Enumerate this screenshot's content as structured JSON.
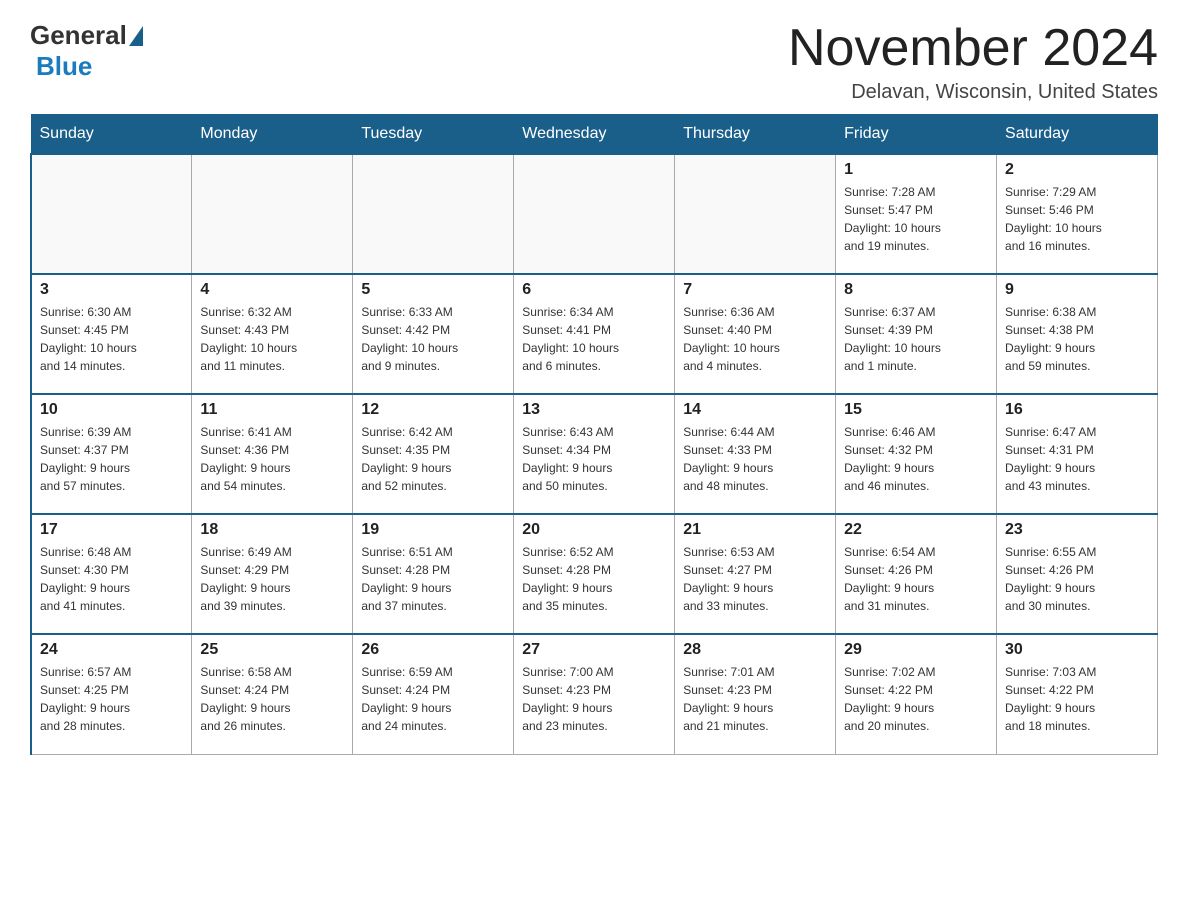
{
  "header": {
    "logo_general": "General",
    "logo_blue": "Blue",
    "title": "November 2024",
    "location": "Delavan, Wisconsin, United States"
  },
  "days_of_week": [
    "Sunday",
    "Monday",
    "Tuesday",
    "Wednesday",
    "Thursday",
    "Friday",
    "Saturday"
  ],
  "weeks": [
    {
      "days": [
        {
          "number": "",
          "info": ""
        },
        {
          "number": "",
          "info": ""
        },
        {
          "number": "",
          "info": ""
        },
        {
          "number": "",
          "info": ""
        },
        {
          "number": "",
          "info": ""
        },
        {
          "number": "1",
          "info": "Sunrise: 7:28 AM\nSunset: 5:47 PM\nDaylight: 10 hours\nand 19 minutes."
        },
        {
          "number": "2",
          "info": "Sunrise: 7:29 AM\nSunset: 5:46 PM\nDaylight: 10 hours\nand 16 minutes."
        }
      ]
    },
    {
      "days": [
        {
          "number": "3",
          "info": "Sunrise: 6:30 AM\nSunset: 4:45 PM\nDaylight: 10 hours\nand 14 minutes."
        },
        {
          "number": "4",
          "info": "Sunrise: 6:32 AM\nSunset: 4:43 PM\nDaylight: 10 hours\nand 11 minutes."
        },
        {
          "number": "5",
          "info": "Sunrise: 6:33 AM\nSunset: 4:42 PM\nDaylight: 10 hours\nand 9 minutes."
        },
        {
          "number": "6",
          "info": "Sunrise: 6:34 AM\nSunset: 4:41 PM\nDaylight: 10 hours\nand 6 minutes."
        },
        {
          "number": "7",
          "info": "Sunrise: 6:36 AM\nSunset: 4:40 PM\nDaylight: 10 hours\nand 4 minutes."
        },
        {
          "number": "8",
          "info": "Sunrise: 6:37 AM\nSunset: 4:39 PM\nDaylight: 10 hours\nand 1 minute."
        },
        {
          "number": "9",
          "info": "Sunrise: 6:38 AM\nSunset: 4:38 PM\nDaylight: 9 hours\nand 59 minutes."
        }
      ]
    },
    {
      "days": [
        {
          "number": "10",
          "info": "Sunrise: 6:39 AM\nSunset: 4:37 PM\nDaylight: 9 hours\nand 57 minutes."
        },
        {
          "number": "11",
          "info": "Sunrise: 6:41 AM\nSunset: 4:36 PM\nDaylight: 9 hours\nand 54 minutes."
        },
        {
          "number": "12",
          "info": "Sunrise: 6:42 AM\nSunset: 4:35 PM\nDaylight: 9 hours\nand 52 minutes."
        },
        {
          "number": "13",
          "info": "Sunrise: 6:43 AM\nSunset: 4:34 PM\nDaylight: 9 hours\nand 50 minutes."
        },
        {
          "number": "14",
          "info": "Sunrise: 6:44 AM\nSunset: 4:33 PM\nDaylight: 9 hours\nand 48 minutes."
        },
        {
          "number": "15",
          "info": "Sunrise: 6:46 AM\nSunset: 4:32 PM\nDaylight: 9 hours\nand 46 minutes."
        },
        {
          "number": "16",
          "info": "Sunrise: 6:47 AM\nSunset: 4:31 PM\nDaylight: 9 hours\nand 43 minutes."
        }
      ]
    },
    {
      "days": [
        {
          "number": "17",
          "info": "Sunrise: 6:48 AM\nSunset: 4:30 PM\nDaylight: 9 hours\nand 41 minutes."
        },
        {
          "number": "18",
          "info": "Sunrise: 6:49 AM\nSunset: 4:29 PM\nDaylight: 9 hours\nand 39 minutes."
        },
        {
          "number": "19",
          "info": "Sunrise: 6:51 AM\nSunset: 4:28 PM\nDaylight: 9 hours\nand 37 minutes."
        },
        {
          "number": "20",
          "info": "Sunrise: 6:52 AM\nSunset: 4:28 PM\nDaylight: 9 hours\nand 35 minutes."
        },
        {
          "number": "21",
          "info": "Sunrise: 6:53 AM\nSunset: 4:27 PM\nDaylight: 9 hours\nand 33 minutes."
        },
        {
          "number": "22",
          "info": "Sunrise: 6:54 AM\nSunset: 4:26 PM\nDaylight: 9 hours\nand 31 minutes."
        },
        {
          "number": "23",
          "info": "Sunrise: 6:55 AM\nSunset: 4:26 PM\nDaylight: 9 hours\nand 30 minutes."
        }
      ]
    },
    {
      "days": [
        {
          "number": "24",
          "info": "Sunrise: 6:57 AM\nSunset: 4:25 PM\nDaylight: 9 hours\nand 28 minutes."
        },
        {
          "number": "25",
          "info": "Sunrise: 6:58 AM\nSunset: 4:24 PM\nDaylight: 9 hours\nand 26 minutes."
        },
        {
          "number": "26",
          "info": "Sunrise: 6:59 AM\nSunset: 4:24 PM\nDaylight: 9 hours\nand 24 minutes."
        },
        {
          "number": "27",
          "info": "Sunrise: 7:00 AM\nSunset: 4:23 PM\nDaylight: 9 hours\nand 23 minutes."
        },
        {
          "number": "28",
          "info": "Sunrise: 7:01 AM\nSunset: 4:23 PM\nDaylight: 9 hours\nand 21 minutes."
        },
        {
          "number": "29",
          "info": "Sunrise: 7:02 AM\nSunset: 4:22 PM\nDaylight: 9 hours\nand 20 minutes."
        },
        {
          "number": "30",
          "info": "Sunrise: 7:03 AM\nSunset: 4:22 PM\nDaylight: 9 hours\nand 18 minutes."
        }
      ]
    }
  ]
}
